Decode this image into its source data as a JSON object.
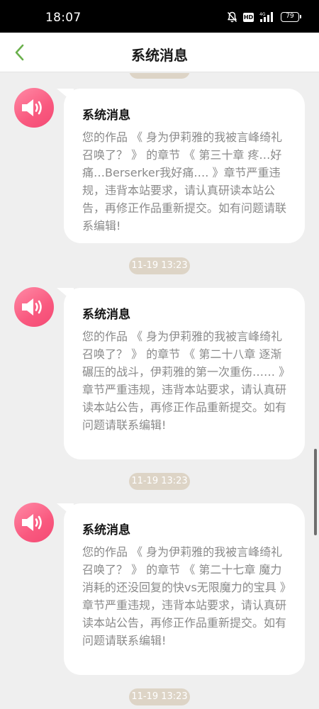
{
  "status_bar": {
    "time": "18:07",
    "hd_label": "HD",
    "battery": "79",
    "icons": [
      "bell-muted-icon",
      "hd-icon",
      "signal-4g-icon",
      "battery-icon"
    ]
  },
  "header": {
    "title": "系统消息",
    "back_icon": "chevron-left-icon",
    "accent_color": "#6ab04c"
  },
  "colors": {
    "avatar_start": "#ff8aa6",
    "avatar_end": "#f44a74",
    "timestamp_pill": "#ddd4c6",
    "body_text": "#8a8a8a"
  },
  "messages": [
    {
      "title": "系统消息",
      "body": "您的作品 《 身为伊莉雅的我被言峰绮礼召唤了？ 》 的章节 《 第三十章 疼…好痛…Berserker我好痛…. 》章节严重违规，违背本站要求，请认真研读本站公告，再修正作品重新提交。如有问题请联系编辑!",
      "timestamp": "11-19 13:23"
    },
    {
      "title": "系统消息",
      "body": "您的作品 《 身为伊莉雅的我被言峰绮礼召唤了？ 》 的章节 《 第二十八章 逐渐碾压的战斗，伊莉雅的第一次重伤…… 》章节严重违规，违背本站要求，请认真研读本站公告，再修正作品重新提交。如有问题请联系编辑!",
      "timestamp": "11-19 13:23"
    },
    {
      "title": "系统消息",
      "body": "您的作品 《 身为伊莉雅的我被言峰绮礼召唤了？ 》 的章节 《 第二十七章 魔力消耗的还没回复的快vs无限魔力的宝具 》章节严重违规，违背本站要求，请认真研读本站公告，再修正作品重新提交。如有问题请联系编辑!",
      "timestamp": "11-19 13:23"
    }
  ]
}
